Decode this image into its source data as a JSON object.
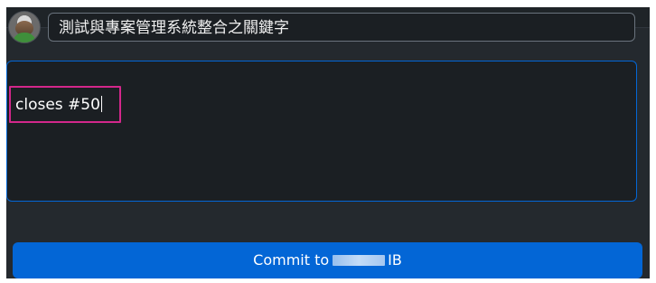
{
  "summary": {
    "value": "測試與專案管理系統整合之關鍵字"
  },
  "description": {
    "value": "closes #50"
  },
  "commit_button": {
    "prefix": "Commit to",
    "suffix": "IB"
  },
  "colors": {
    "panel_bg": "#24292e",
    "input_bg": "#1b1f23",
    "focus_border": "#0366d6",
    "highlight": "#d3278b",
    "button_bg": "#0366d6"
  }
}
